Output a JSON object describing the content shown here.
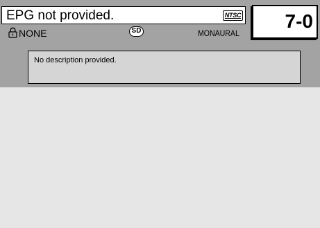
{
  "program": {
    "title": "EPG not provided.",
    "description": "No description provided."
  },
  "channel": {
    "number": "7-0"
  },
  "badges": {
    "broadcast_standard": "NTSC",
    "definition": "SD"
  },
  "status": {
    "parental_lock_icon": "lock-icon",
    "rating": "NONE",
    "audio": "MONAURAL"
  },
  "colors": {
    "panel_background": "#a3a3a3",
    "screen_background": "#e6e6e6",
    "description_background": "#d5d5d5"
  }
}
